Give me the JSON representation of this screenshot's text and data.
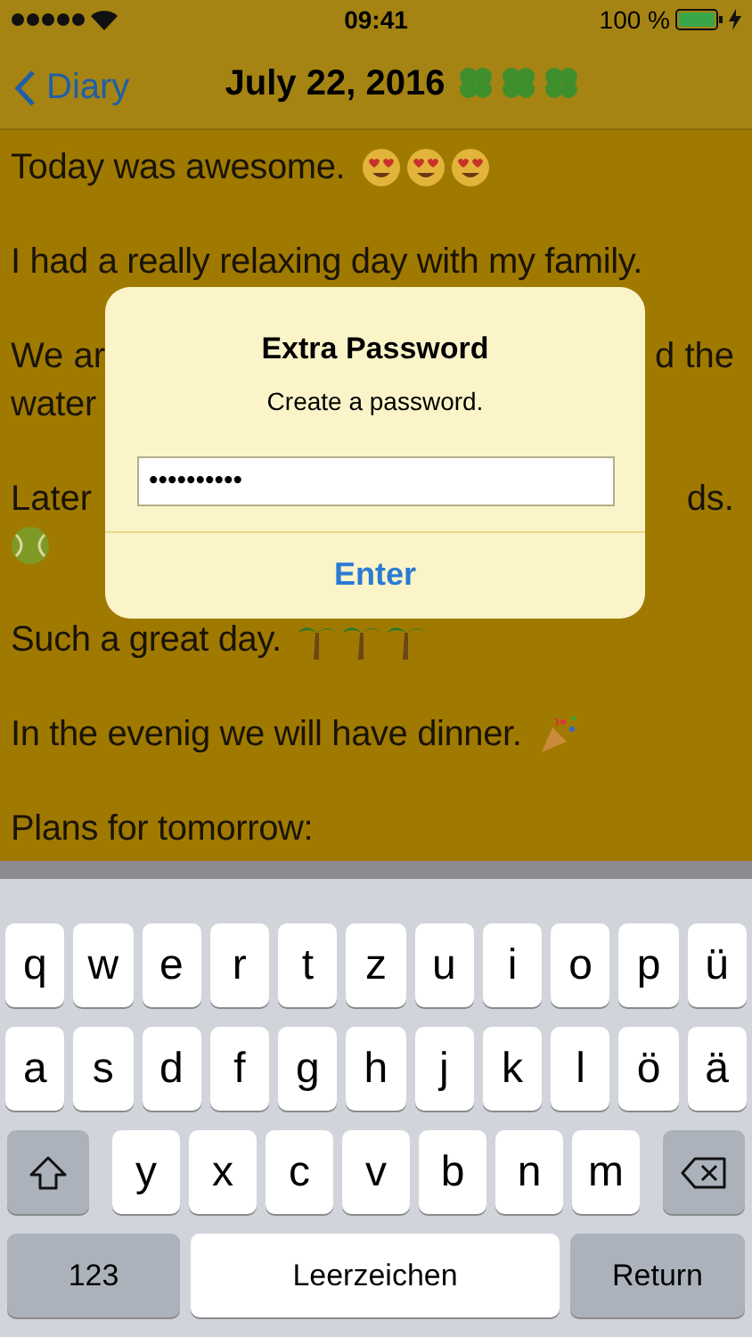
{
  "status_bar": {
    "time": "09:41",
    "battery": "100 %"
  },
  "nav": {
    "back": "Diary",
    "title": "July 22, 2016"
  },
  "paragraphs": [
    {
      "lines": [
        {
          "text": "Today was awesome."
        }
      ]
    },
    {
      "lines": [
        {
          "text": "I had a really relaxing day with my family."
        }
      ]
    },
    {
      "lines": [
        {
          "left": "We ar",
          "right": "d the"
        },
        {
          "text": "water"
        }
      ]
    },
    {
      "lines": [
        {
          "left": "Later",
          "right": "ds."
        }
      ]
    },
    {
      "lines": [
        {
          "text": "Such a great day."
        }
      ]
    },
    {
      "lines": [
        {
          "text": "In the evenig we will have dinner."
        }
      ]
    },
    {
      "lines": [
        {
          "text": "Plans for tomorrow:"
        }
      ]
    }
  ],
  "dialog": {
    "title": "Extra Password",
    "message": "Create a password.",
    "value": "••••••••••",
    "button": "Enter"
  },
  "keyboard": {
    "rows": [
      {
        "keys": [
          "q",
          "w",
          "e",
          "r",
          "t",
          "z",
          "u",
          "i",
          "o",
          "p",
          "ü"
        ]
      },
      {
        "keys": [
          "a",
          "s",
          "d",
          "f",
          "g",
          "h",
          "j",
          "k",
          "l",
          "ö",
          "ä"
        ]
      },
      {
        "keys": [
          "y",
          "x",
          "c",
          "v",
          "b",
          "n",
          "m"
        ]
      }
    ],
    "numbers": "123",
    "space": "Leerzeichen",
    "return": "Return"
  }
}
